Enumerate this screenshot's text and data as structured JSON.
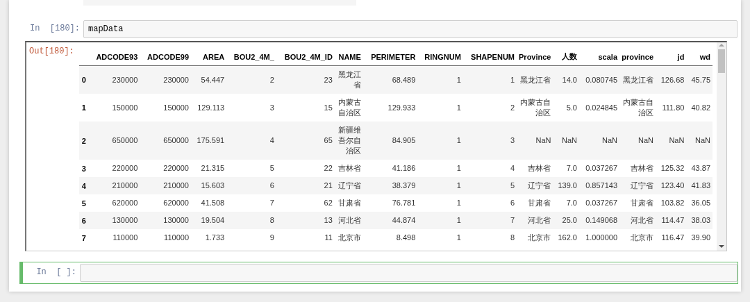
{
  "cells": [
    {
      "prompt": "In  [180]:",
      "code": "mapData",
      "selected": false,
      "output": {
        "prompt": "Out[180]:",
        "table": {
          "columns": [
            "ADCODE93",
            "ADCODE99",
            "AREA",
            "BOU2_4M_",
            "BOU2_4M_ID",
            "NAME",
            "PERIMETER",
            "RINGNUM",
            "SHAPENUM",
            "Province",
            "人数",
            "scala",
            "province",
            "jd",
            "wd"
          ],
          "rows": [
            {
              "index": "0",
              "cells": [
                "230000",
                "230000",
                "54.447",
                "2",
                "23",
                "黑龙江省",
                "68.489",
                "1",
                "1",
                "黑龙江省",
                "14.0",
                "0.080745",
                "黑龙江省",
                "126.68",
                "45.75"
              ]
            },
            {
              "index": "1",
              "cells": [
                "150000",
                "150000",
                "129.113",
                "3",
                "15",
                "内蒙古自治区",
                "129.933",
                "1",
                "2",
                "内蒙古自治区",
                "5.0",
                "0.024845",
                "内蒙古自治区",
                "111.80",
                "40.82"
              ]
            },
            {
              "index": "2",
              "cells": [
                "650000",
                "650000",
                "175.591",
                "4",
                "65",
                "新疆维吾尔自治区",
                "84.905",
                "1",
                "3",
                "NaN",
                "NaN",
                "NaN",
                "NaN",
                "NaN",
                "NaN"
              ]
            },
            {
              "index": "3",
              "cells": [
                "220000",
                "220000",
                "21.315",
                "5",
                "22",
                "吉林省",
                "41.186",
                "1",
                "4",
                "吉林省",
                "7.0",
                "0.037267",
                "吉林省",
                "125.32",
                "43.87"
              ]
            },
            {
              "index": "4",
              "cells": [
                "210000",
                "210000",
                "15.603",
                "6",
                "21",
                "辽宁省",
                "38.379",
                "1",
                "5",
                "辽宁省",
                "139.0",
                "0.857143",
                "辽宁省",
                "123.40",
                "41.83"
              ]
            },
            {
              "index": "5",
              "cells": [
                "620000",
                "620000",
                "41.508",
                "7",
                "62",
                "甘肃省",
                "76.781",
                "1",
                "6",
                "甘肃省",
                "7.0",
                "0.037267",
                "甘肃省",
                "103.82",
                "36.05"
              ]
            },
            {
              "index": "6",
              "cells": [
                "130000",
                "130000",
                "19.504",
                "8",
                "13",
                "河北省",
                "44.874",
                "1",
                "7",
                "河北省",
                "25.0",
                "0.149068",
                "河北省",
                "114.47",
                "38.03"
              ]
            },
            {
              "index": "7",
              "cells": [
                "110000",
                "110000",
                "1.733",
                "9",
                "11",
                "北京市",
                "8.498",
                "1",
                "8",
                "北京市",
                "162.0",
                "1.000000",
                "北京市",
                "116.47",
                "39.90"
              ]
            }
          ]
        }
      }
    },
    {
      "prompt": "In  [ ]:",
      "selected": true
    }
  ]
}
